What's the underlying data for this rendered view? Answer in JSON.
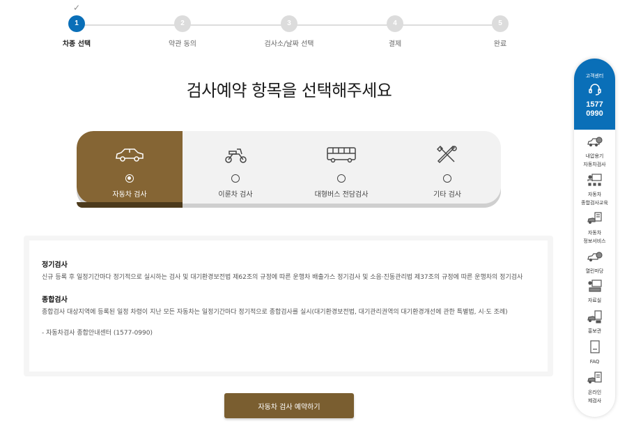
{
  "stepper": {
    "check": "✓",
    "steps": [
      {
        "num": "1",
        "label": "차종 선택"
      },
      {
        "num": "2",
        "label": "약관 동의"
      },
      {
        "num": "3",
        "label": "검사소/날짜 선택"
      },
      {
        "num": "4",
        "label": "결제"
      },
      {
        "num": "5",
        "label": "완료"
      }
    ]
  },
  "title": "검사예약 항목을 선택해주세요",
  "categories": [
    {
      "label": "자동차 검사",
      "icon": "car-icon",
      "selected": true
    },
    {
      "label": "이륜차 검사",
      "icon": "motorcycle-icon"
    },
    {
      "label": "대형버스 전담검사",
      "icon": "bus-icon"
    },
    {
      "label": "기타 검사",
      "icon": "tools-icon"
    }
  ],
  "info": {
    "sec1_title": "정기검사",
    "sec1_text": "신규 등록 후 일정기간마다 정기적으로 실시하는 검사 및 대기환경보전법 제62조의 규정에 따른 운행차 배출가스 정기검사 및 소음·진동관리법 제37조의 규정에 따른 운행차의 정기검사",
    "sec2_title": "종합검사",
    "sec2_text": "종합검사 대상지역에 등록된 일정 차령이 지난 모든 자동차는 일정기간마다 정기적으로 종합검사를 실시(대기환경보전법, 대기관리권역의 대기환경개선에 관한 특별법, 시·도 조례)",
    "contact": "- 자동차검사 종합안내센터 (1577-0990)"
  },
  "submit_label": "자동차 검사 예약하기",
  "sidebar": {
    "cs_label": "고객센터",
    "phone_1": "1577",
    "phone_2": "0990",
    "items": [
      {
        "label_1": "내압용기",
        "label_2": "자동차검사",
        "icon": "cylinder-car-icon"
      },
      {
        "label_1": "자동차",
        "label_2": "종합검사교육",
        "icon": "education-icon"
      },
      {
        "label_1": "자동차",
        "label_2": "정보서비스",
        "icon": "car-info-icon"
      },
      {
        "label_1": "열린마당",
        "label_2": "",
        "icon": "open-forum-icon"
      },
      {
        "label_1": "자료실",
        "label_2": "",
        "icon": "archive-icon"
      },
      {
        "label_1": "홍보관",
        "label_2": "",
        "icon": "promotion-icon"
      },
      {
        "label_1": "FAQ",
        "label_2": "",
        "icon": "faq-icon"
      },
      {
        "label_1": "온라인",
        "label_2": "제검사",
        "icon": "online-recheck-icon"
      }
    ]
  },
  "colors": {
    "accent_blue": "#0a6fb8",
    "brown": "#856534",
    "button_brown": "#7a5e30"
  }
}
